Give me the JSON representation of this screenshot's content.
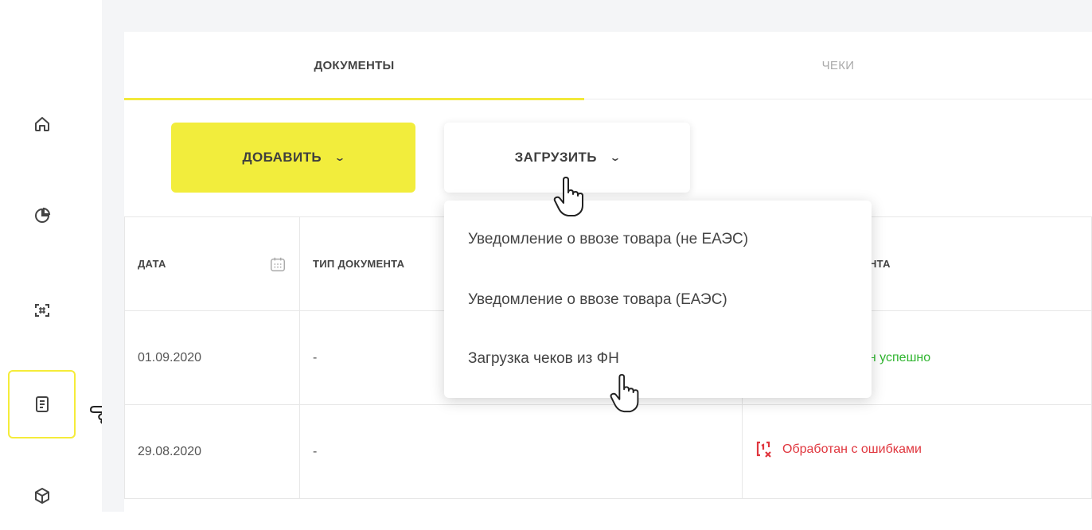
{
  "sidebar": {
    "items": [
      {
        "icon": "home-icon"
      },
      {
        "icon": "pie-chart-icon"
      },
      {
        "icon": "scan-icon"
      },
      {
        "icon": "document-icon",
        "active": true
      },
      {
        "icon": "box-icon"
      }
    ]
  },
  "tabs": {
    "documents": "ДОКУМЕНТЫ",
    "checks": "ЧЕКИ"
  },
  "toolbar": {
    "add_label": "ДОБАВИТЬ",
    "load_label": "ЗАГРУЗИТЬ"
  },
  "dropdown": {
    "items": [
      "Уведомление о ввозе товара (не ЕАЭС)",
      "Уведомление о ввозе товара (ЕАЭС)",
      "Загрузка чеков из ФН"
    ]
  },
  "table": {
    "headers": {
      "date": "ДАТА",
      "type": "ТИП ДОКУМЕНТА",
      "status": "ЕНТА"
    },
    "rows": [
      {
        "date": "01.09.2020",
        "type": "-",
        "status": "ан успешно",
        "status_kind": "success"
      },
      {
        "date": "29.08.2020",
        "type": "-",
        "status": "Обработан с ошибками",
        "status_kind": "error"
      }
    ]
  },
  "colors": {
    "accent": "#f2ed3c",
    "success": "#2fb52f",
    "error": "#e0363e"
  }
}
